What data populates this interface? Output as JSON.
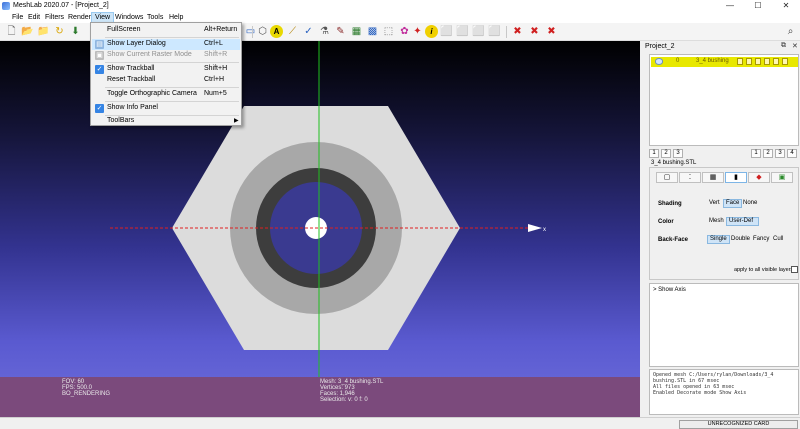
{
  "window": {
    "title": "MeshLab 2020.07 - [Project_2]",
    "minimize": "—",
    "maximize": "☐",
    "close": "✕"
  },
  "menubar": {
    "items": [
      "File",
      "Edit",
      "Filters",
      "Render",
      "View",
      "Windows",
      "Tools",
      "Help"
    ]
  },
  "view_menu": {
    "items": [
      {
        "label": "FullScreen",
        "shortcut": "Alt+Return"
      },
      {
        "label": "Show Layer Dialog",
        "shortcut": "Ctrl+L"
      },
      {
        "label": "Show Current Raster Mode",
        "shortcut": "Shift+R"
      },
      {
        "label": "Show Trackball",
        "shortcut": "Shift+H"
      },
      {
        "label": "Reset Trackball",
        "shortcut": "Ctrl+H"
      },
      {
        "label": "Toggle Orthographic Camera",
        "shortcut": "Num+5"
      },
      {
        "label": "Show Info Panel",
        "shortcut": ""
      },
      {
        "label": "ToolBars",
        "shortcut": ""
      }
    ]
  },
  "toolbar": {
    "search_icon": "magnifier-icon"
  },
  "viewport": {
    "axis_label": "x",
    "info_left": [
      "FOV: 60",
      "FPS:  500.0",
      "BO_RENDERING"
    ],
    "info_right": [
      "Mesh: 3_4 bushing.STL",
      "Vertices: 973",
      "Faces: 1,946",
      "Selection: v: 0 f: 0"
    ],
    "colors": {
      "background_top": "#000000",
      "background_bottom": "#6e6edc",
      "info_panel": "#7b4a7c",
      "x_axis": "#e02020",
      "y_axis": "#20c020"
    }
  },
  "layers": {
    "title": "Project_2",
    "rows": [
      {
        "index": "0",
        "name": "3_4 bushing"
      }
    ],
    "page_buttons": [
      "1",
      "2",
      "3",
      "4"
    ],
    "mesh_name": "3_4 bushing.STL"
  },
  "render": {
    "shading": {
      "label": "Shading",
      "options": [
        "Vert",
        "Face",
        "None"
      ],
      "selected": "Face"
    },
    "color": {
      "label": "Color",
      "options": [
        "Mesh",
        "User-Def"
      ],
      "selected": "User-Def"
    },
    "backface": {
      "label": "Back-Face",
      "options": [
        "Single",
        "Double",
        "Fancy",
        "Cull"
      ],
      "selected": "Single"
    },
    "apply_all": "apply to all visible layers"
  },
  "decorate": {
    "item": "> Show Axis"
  },
  "log": [
    "Opened mesh C:/Users/rylan/Downloads/3_4",
    "bushing.STL in 67 msec",
    "All files opened in 63 msec",
    "Enabled Decorate mode Show Axis"
  ],
  "status": {
    "card": "UNRECOGNIZED CARD"
  }
}
